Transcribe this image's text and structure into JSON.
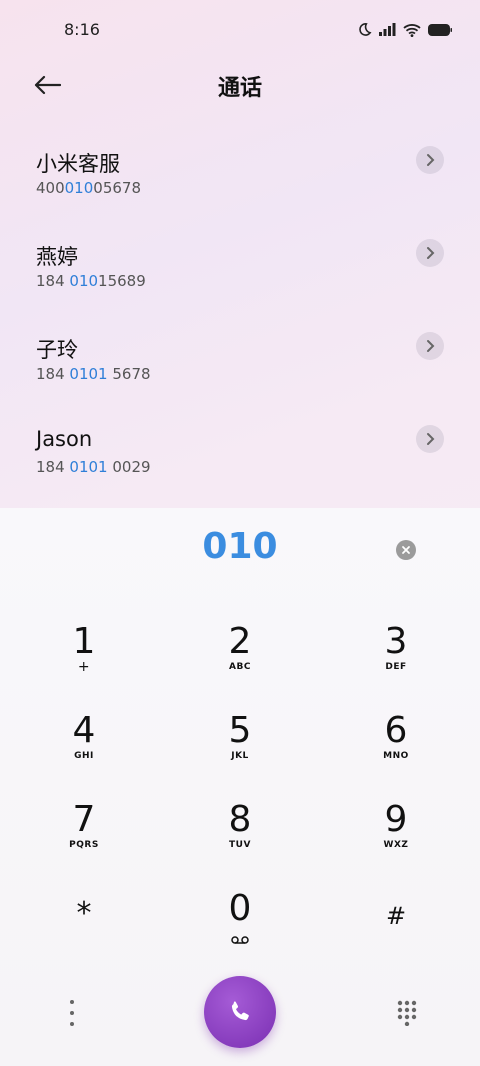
{
  "status": {
    "time": "8:16"
  },
  "header": {
    "title": "通话"
  },
  "contacts": [
    {
      "name": "小米客服",
      "number_pre": "400",
      "number_hl": "010",
      "number_post": "05678"
    },
    {
      "name": "燕婷",
      "number_pre": "184 ",
      "number_hl": "010",
      "number_post": "15689"
    },
    {
      "name": "子玲",
      "number_pre": "184 ",
      "number_hl": "0101",
      "number_post": " 5678"
    },
    {
      "name": "Jason",
      "number_pre": "184 ",
      "number_hl": "0101",
      "number_post": " 0029"
    }
  ],
  "dialer": {
    "input": "010",
    "keys": [
      {
        "digit": "1",
        "letters": "+"
      },
      {
        "digit": "2",
        "letters": "ABC"
      },
      {
        "digit": "3",
        "letters": "DEF"
      },
      {
        "digit": "4",
        "letters": "GHI"
      },
      {
        "digit": "5",
        "letters": "JKL"
      },
      {
        "digit": "6",
        "letters": "MNO"
      },
      {
        "digit": "7",
        "letters": "PQRS"
      },
      {
        "digit": "8",
        "letters": "TUV"
      },
      {
        "digit": "9",
        "letters": "WXZ"
      },
      {
        "digit": "*",
        "letters": ""
      },
      {
        "digit": "0",
        "letters": ""
      },
      {
        "digit": "#",
        "letters": ""
      }
    ]
  },
  "colors": {
    "accent": "#3b8de0",
    "call_button": "#8a3cc0"
  },
  "icons": [
    "moon-icon",
    "signal-icon",
    "wifi-icon",
    "battery-icon",
    "back-arrow-icon",
    "chevron-right-icon",
    "clear-icon",
    "voicemail-icon",
    "more-icon",
    "phone-icon",
    "dialpad-grid-icon"
  ]
}
